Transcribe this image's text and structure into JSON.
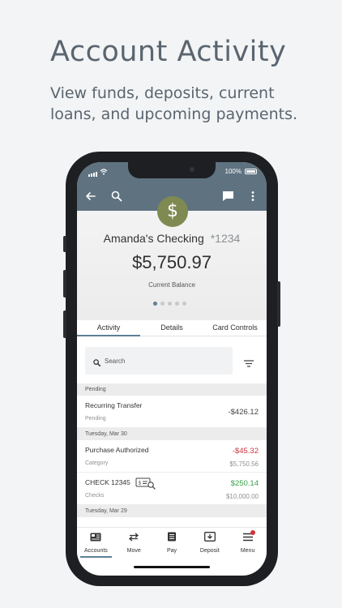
{
  "promo": {
    "headline": "Account Activity",
    "subhead": "View funds, deposits, current loans, and upcoming payments."
  },
  "status_bar": {
    "battery": "100%"
  },
  "account": {
    "name": "Amanda's Checking",
    "mask": "*1234",
    "balance": "$5,750.97",
    "balance_label": "Current Balance",
    "icon": "dollar-sign-icon",
    "icon_color": "#7f8a52"
  },
  "carousel": {
    "total": 5,
    "active_index": 0
  },
  "tabs": [
    {
      "label": "Activity",
      "active": true
    },
    {
      "label": "Details",
      "active": false
    },
    {
      "label": "Card Controls",
      "active": false
    }
  ],
  "search": {
    "placeholder": "Search"
  },
  "sections": [
    {
      "header": "Pending",
      "rows": [
        {
          "title": "Recurring Transfer",
          "subtitle": "Pending",
          "amount": "-$426.12",
          "amount_type": "neutral",
          "balance": ""
        }
      ]
    },
    {
      "header": "Tuesday, Mar 30",
      "rows": [
        {
          "title": "Purchase Authorized",
          "subtitle": "Category",
          "amount": "-$45.32",
          "amount_type": "negative",
          "balance": "$5,750.56"
        },
        {
          "title": "CHECK 12345",
          "subtitle": "Checks",
          "amount": "$250.14",
          "amount_type": "positive",
          "balance": "$10,000.00"
        }
      ]
    },
    {
      "header": "Tuesday, Mar 29",
      "rows": []
    }
  ],
  "bottom_nav": [
    {
      "label": "Accounts",
      "icon": "accounts-icon",
      "active": true
    },
    {
      "label": "Move",
      "icon": "move-arrows-icon",
      "active": false
    },
    {
      "label": "Pay",
      "icon": "pay-bill-icon",
      "active": false
    },
    {
      "label": "Deposit",
      "icon": "deposit-icon",
      "active": false
    },
    {
      "label": "Menu",
      "icon": "menu-icon",
      "active": false,
      "badge": true
    }
  ],
  "colors": {
    "header": "#5f7280",
    "accent": "#5f7f96",
    "negative": "#d0343a",
    "positive": "#3aa04a"
  }
}
